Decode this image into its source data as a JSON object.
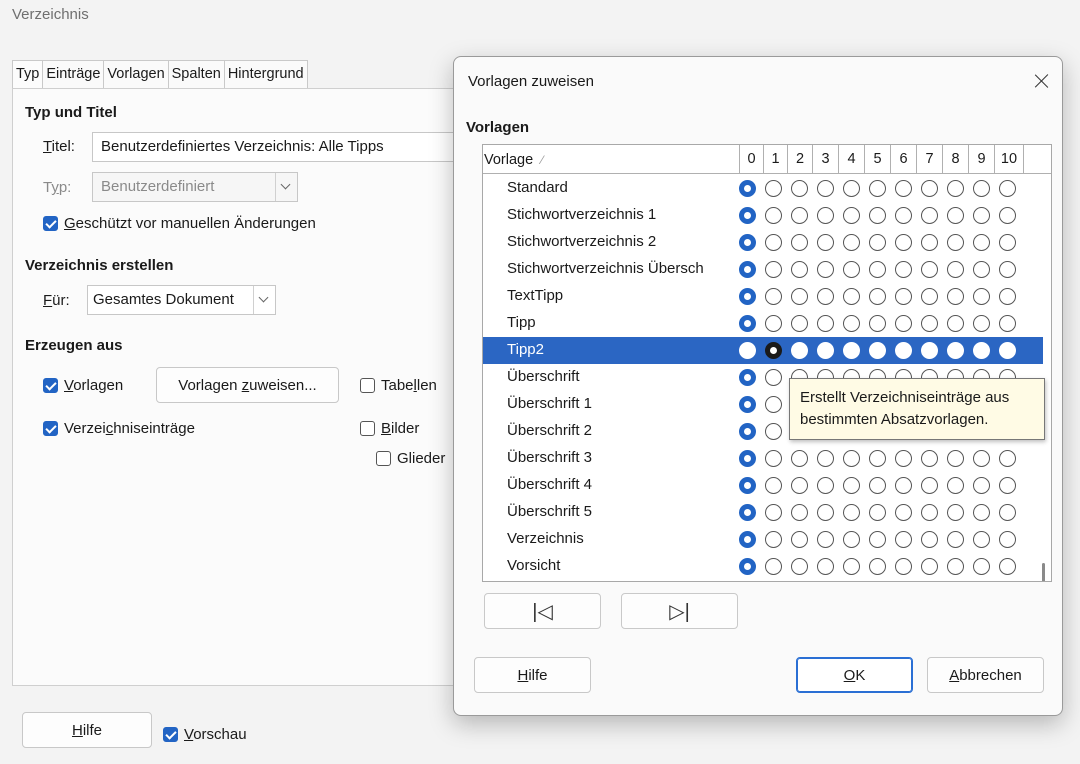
{
  "background_dialog": {
    "title": "Verzeichnis",
    "tabs": [
      "Typ",
      "Einträge",
      "Vorlagen",
      "Spalten",
      "Hintergrund"
    ],
    "section_type_title": "Typ und Titel",
    "title_label_pre": "T",
    "title_label_post": "itel:",
    "title_value": "Benutzerdefiniertes Verzeichnis: Alle Tipps",
    "type_label_pre": "T",
    "type_label_u": "y",
    "type_label_post": "p:",
    "type_value": "Benutzerdefiniert",
    "protected_label_u": "G",
    "protected_label_post": "eschützt vor manuellen Änderungen",
    "protected_checked": true,
    "section_create": "Verzeichnis erstellen",
    "for_label_u": "F",
    "for_label_post": "ür:",
    "for_value": "Gesamtes Dokument",
    "section_generate": "Erzeugen aus",
    "styles_cb_u": "V",
    "styles_cb_post": "orlagen",
    "styles_checked": true,
    "assign_btn_pre": "Vorlagen ",
    "assign_btn_u": "z",
    "assign_btn_post": "uweisen...",
    "tables_cb_pre": "Tabe",
    "tables_cb_u": "l",
    "tables_cb_post": "len",
    "tables_checked": false,
    "entries_cb_pre": "Verzei",
    "entries_cb_u": "c",
    "entries_cb_post": "hniseinträge",
    "entries_checked": true,
    "images_cb_u": "B",
    "images_cb_post": "ilder",
    "images_checked": false,
    "outline_cb": "Glieder",
    "outline_checked": false,
    "help_u": "H",
    "help_post": "ilfe",
    "preview_u": "V",
    "preview_post": "orschau",
    "preview_checked": true
  },
  "dialog": {
    "title": "Vorlagen zuweisen",
    "section": "Vorlagen",
    "col_header": "Vorlage",
    "level_headers": [
      "0",
      "1",
      "2",
      "3",
      "4",
      "5",
      "6",
      "7",
      "8",
      "9",
      "10"
    ],
    "rows": [
      {
        "name": "Standard",
        "level": 0,
        "selected": false
      },
      {
        "name": "Stichwortverzeichnis 1",
        "level": 0,
        "selected": false
      },
      {
        "name": "Stichwortverzeichnis 2",
        "level": 0,
        "selected": false
      },
      {
        "name": "Stichwortverzeichnis Übersch",
        "level": 0,
        "selected": false
      },
      {
        "name": "TextTipp",
        "level": 0,
        "selected": false
      },
      {
        "name": "Tipp",
        "level": 0,
        "selected": false
      },
      {
        "name": "Tipp2",
        "level": 1,
        "selected": true
      },
      {
        "name": "Überschrift",
        "level": 0,
        "selected": false
      },
      {
        "name": "Überschrift 1",
        "level": 0,
        "selected": false
      },
      {
        "name": "Überschrift 2",
        "level": 0,
        "selected": false
      },
      {
        "name": "Überschrift 3",
        "level": 0,
        "selected": false
      },
      {
        "name": "Überschrift 4",
        "level": 0,
        "selected": false
      },
      {
        "name": "Überschrift 5",
        "level": 0,
        "selected": false
      },
      {
        "name": "Verzeichnis",
        "level": 0,
        "selected": false
      },
      {
        "name": "Vorsicht",
        "level": 0,
        "selected": false
      }
    ],
    "tooltip_line1": "Erstellt Verzeichniseinträge aus",
    "tooltip_line2": "bestimmten Absatzvorlagen.",
    "nav_left": "|◁",
    "nav_right": "▷|",
    "help_u": "H",
    "help_post": "ilfe",
    "ok_u": "O",
    "ok_post": "K",
    "cancel_u": "A",
    "cancel_post": "bbrechen",
    "accent_color": "#2264c4",
    "selection_color": "#2b66c3"
  }
}
